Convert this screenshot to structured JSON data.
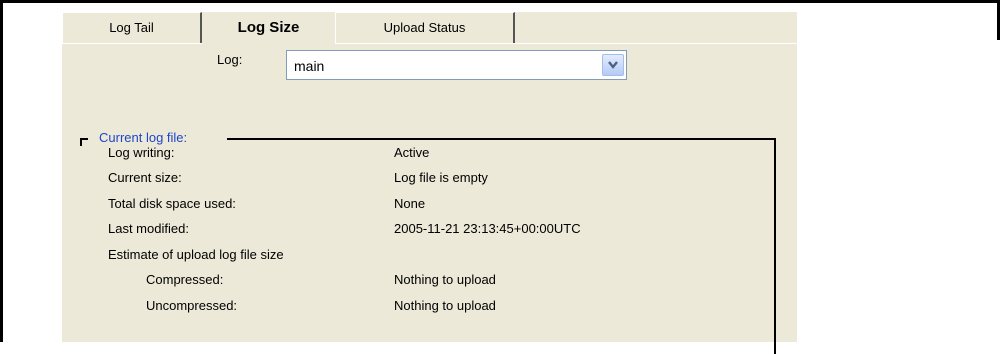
{
  "tabs": [
    {
      "label": "Log Tail",
      "active": false
    },
    {
      "label": "Log Size",
      "active": true
    },
    {
      "label": "Upload Status",
      "active": false
    }
  ],
  "log_select": {
    "label": "Log:",
    "value": "main"
  },
  "group": {
    "title": "Current log file:",
    "rows": [
      {
        "label": "Log writing:",
        "value": "Active"
      },
      {
        "label": "Current size:",
        "value": "Log file is empty"
      },
      {
        "label": "Total disk space used:",
        "value": "None"
      },
      {
        "label": "Last modified:",
        "value": "2005-11-21 23:13:45+00:00UTC"
      },
      {
        "label": "Estimate of upload log file size",
        "value": ""
      },
      {
        "label": "Compressed:",
        "value": "Nothing to upload"
      },
      {
        "label": "Uncompressed:",
        "value": "Nothing to upload"
      }
    ]
  },
  "colors": {
    "panel_bg": "#ece9d8",
    "legend_text": "#1e46c8",
    "select_border": "#7f9db9"
  }
}
